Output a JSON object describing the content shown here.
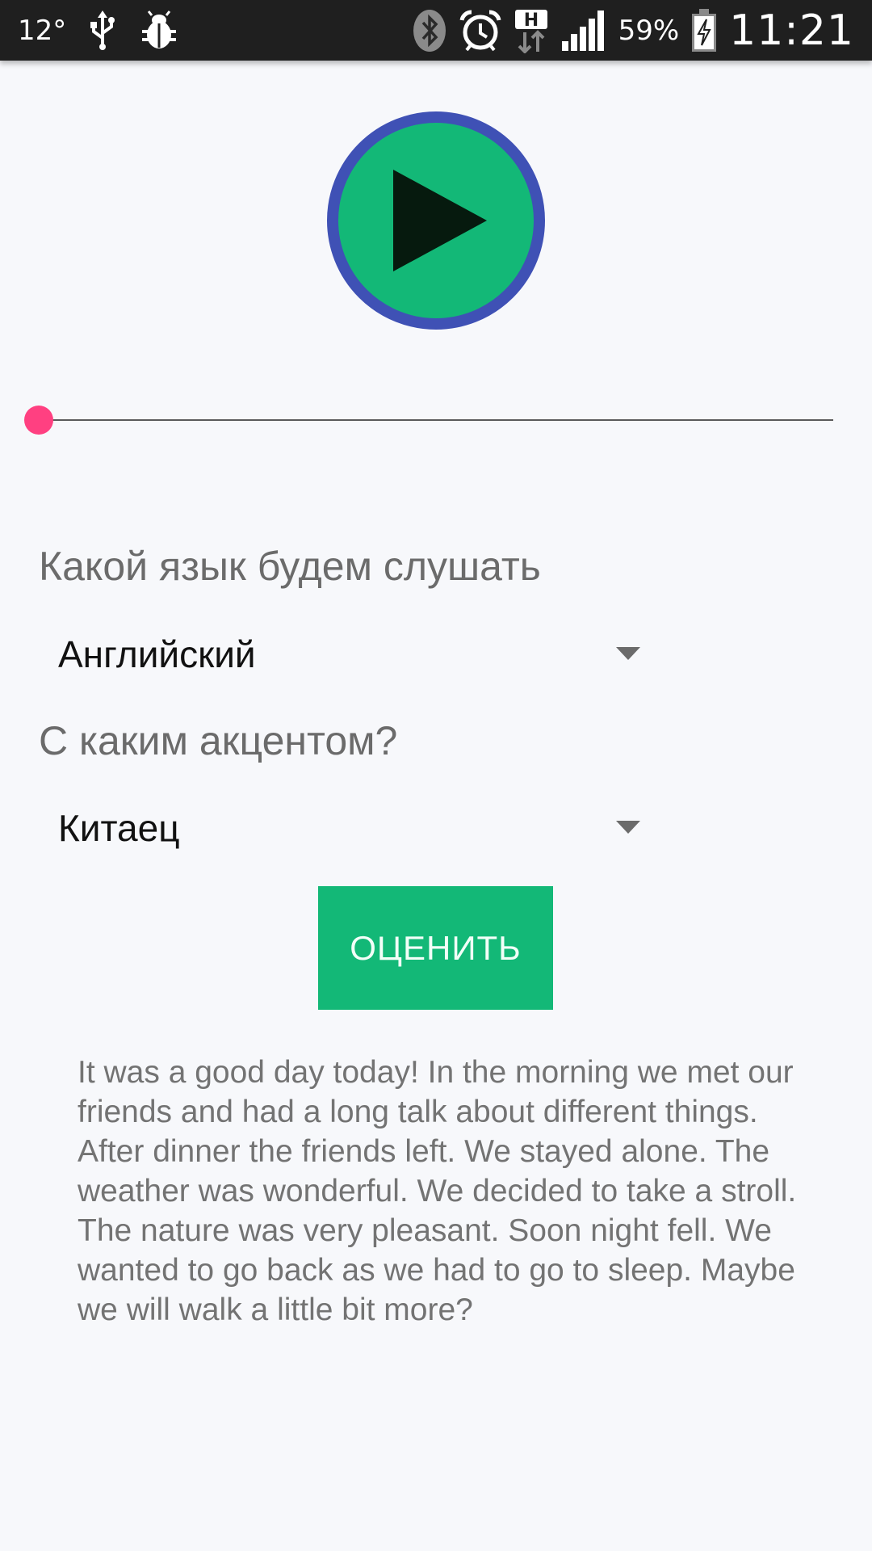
{
  "status_bar": {
    "temperature": "12°",
    "battery_percent": "59%",
    "time": "11:21",
    "network_badge": "H",
    "icons": [
      "usb-icon",
      "debug-bug-icon",
      "bluetooth-icon",
      "alarm-icon",
      "network-h-icon",
      "signal-icon",
      "battery-charging-icon"
    ]
  },
  "player": {
    "play_icon": "play-icon",
    "progress": 0.0,
    "colors": {
      "button_fill": "#13b877",
      "button_ring": "#3f51b5",
      "seek_accent": "#ff4081"
    }
  },
  "form": {
    "language_label": "Какой язык будем слушать",
    "language_value": "Английский",
    "accent_label": "С каким акцентом?",
    "accent_value": "Китаец",
    "evaluate_button": "ОЦЕНИТЬ"
  },
  "text": {
    "passage": "It was a good day today! In the morning we met our friends and had a long talk about different things. After dinner the friends left. We stayed alone. The weather was wonderful. We decided to take a stroll. The nature was very pleasant. Soon night fell. We wanted to go back as we had to go to sleep. Maybe we will walk a little bit more?"
  }
}
